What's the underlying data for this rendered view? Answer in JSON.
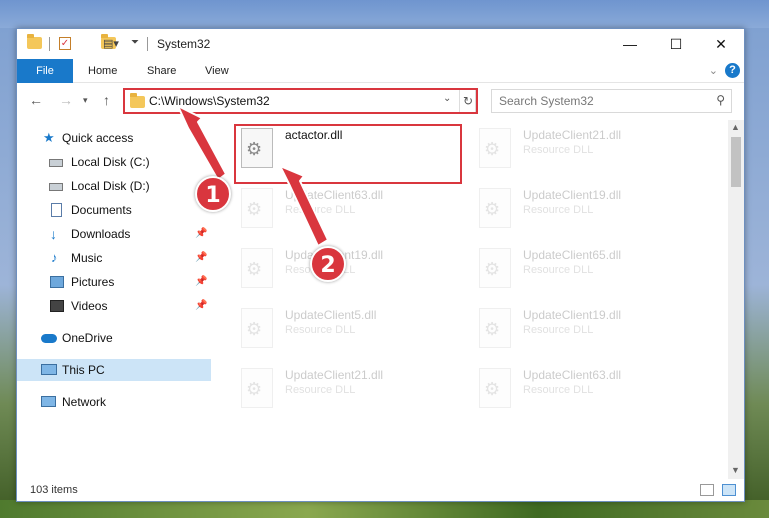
{
  "window": {
    "title": "System32"
  },
  "ribbon": {
    "tabs": [
      "File",
      "Home",
      "Share",
      "View"
    ]
  },
  "address": {
    "path": "C:\\Windows\\System32",
    "search_placeholder": "Search System32"
  },
  "sidebar": {
    "items": [
      {
        "label": "Quick access",
        "icon": "star-icon"
      },
      {
        "label": "Local Disk (C:)",
        "icon": "drive-icon"
      },
      {
        "label": "Local Disk (D:)",
        "icon": "drive-icon"
      },
      {
        "label": "Documents",
        "icon": "documents-icon",
        "pinned": false
      },
      {
        "label": "Downloads",
        "icon": "download-icon",
        "pinned": true
      },
      {
        "label": "Music",
        "icon": "music-icon",
        "pinned": true
      },
      {
        "label": "Pictures",
        "icon": "pictures-icon",
        "pinned": true
      },
      {
        "label": "Videos",
        "icon": "videos-icon",
        "pinned": true
      },
      {
        "label": "OneDrive",
        "icon": "cloud-icon"
      },
      {
        "label": "This PC",
        "icon": "computer-icon",
        "selected": true
      },
      {
        "label": "Network",
        "icon": "network-icon"
      }
    ]
  },
  "files": {
    "main": {
      "name": "actactor.dll"
    },
    "ghosts": [
      {
        "name": "UpdateClient21.dll",
        "type": "Resource DLL"
      },
      {
        "name": "UpdateClient63.dll",
        "type": "Resource DLL"
      },
      {
        "name": "UpdateClient19.dll",
        "type": "Resource DLL"
      },
      {
        "name": "UpdateClient19.dll",
        "type": "Resource DLL"
      },
      {
        "name": "UpdateClient65.dll",
        "type": "Resource DLL"
      },
      {
        "name": "UpdateClient5.dll",
        "type": "Resource DLL"
      },
      {
        "name": "UpdateClient19.dll",
        "type": "Resource DLL"
      },
      {
        "name": "UpdateClient21.dll",
        "type": "Resource DLL"
      },
      {
        "name": "UpdateClient63.dll",
        "type": "Resource DLL"
      }
    ]
  },
  "status": {
    "item_count": "103 items"
  },
  "annotations": {
    "step1": "1",
    "step2": "2",
    "color": "#d9363e"
  }
}
